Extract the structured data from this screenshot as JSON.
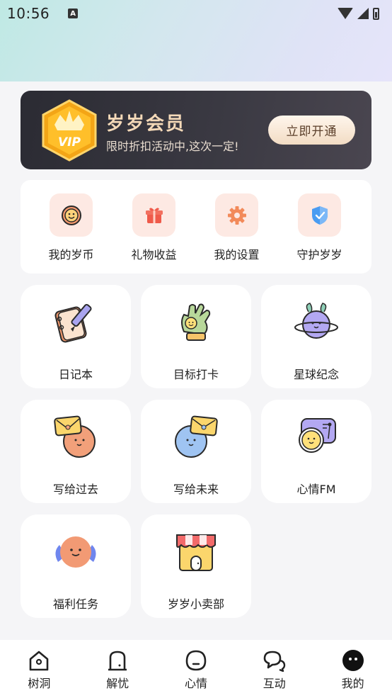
{
  "status": {
    "time": "10:56",
    "notif_glyph": "A"
  },
  "vip": {
    "badge_text": "VIP",
    "title": "岁岁会员",
    "subtitle": "限时折扣活动中,这次一定!",
    "button_label": "立即开通",
    "gold": "#f7b52a"
  },
  "quick": [
    {
      "label": "我的岁币",
      "icon": "smiley-coin-icon"
    },
    {
      "label": "礼物收益",
      "icon": "gift-icon"
    },
    {
      "label": "我的设置",
      "icon": "gear-icon"
    },
    {
      "label": "守护岁岁",
      "icon": "shield-icon"
    }
  ],
  "tiles": [
    {
      "label": "日记本",
      "icon": "notebook-pencil-icon"
    },
    {
      "label": "目标打卡",
      "icon": "glove-thumbs-up-icon"
    },
    {
      "label": "星球纪念",
      "icon": "planet-icon"
    },
    {
      "label": "写给过去",
      "icon": "letter-orange-face-icon"
    },
    {
      "label": "写给未来",
      "icon": "letter-blue-face-icon"
    },
    {
      "label": "心情FM",
      "icon": "radio-face-icon"
    },
    {
      "label": "福利任务",
      "icon": "winged-face-icon"
    },
    {
      "label": "岁岁小卖部",
      "icon": "shop-icon"
    }
  ],
  "nav": [
    {
      "label": "树洞",
      "icon": "tree-hole-icon"
    },
    {
      "label": "解忧",
      "icon": "door-icon"
    },
    {
      "label": "心情",
      "icon": "mood-face-icon"
    },
    {
      "label": "互动",
      "icon": "chat-bubbles-icon"
    },
    {
      "label": "我的",
      "icon": "profile-face-icon",
      "active": true
    }
  ],
  "colors": {
    "accent_peach": "#fde9e3",
    "vip_dark": "#2b2b33"
  }
}
